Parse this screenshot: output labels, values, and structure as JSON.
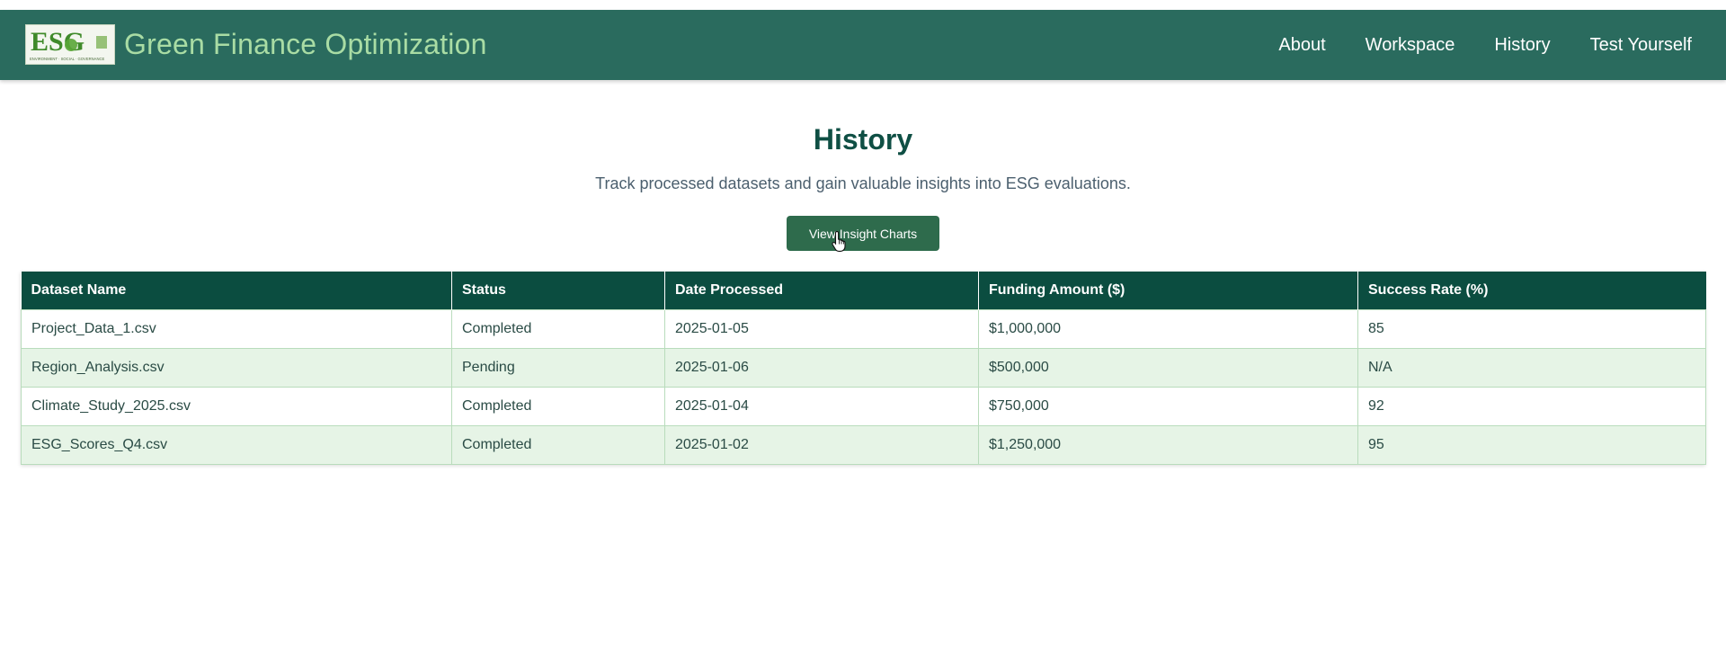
{
  "header": {
    "logo_text": "ESG",
    "logo_subtext": "ENVIRONMENT · SOCIAL · GOVERNANCE",
    "title": "Green Finance Optimization",
    "nav": [
      {
        "label": "About"
      },
      {
        "label": "Workspace"
      },
      {
        "label": "History"
      },
      {
        "label": "Test Yourself"
      }
    ]
  },
  "main": {
    "title": "History",
    "subtitle": "Track processed datasets and gain valuable insights into ESG evaluations.",
    "button_label": "View Insight Charts"
  },
  "table": {
    "columns": [
      "Dataset Name",
      "Status",
      "Date Processed",
      "Funding Amount ($)",
      "Success Rate (%)"
    ],
    "rows": [
      [
        "Project_Data_1.csv",
        "Completed",
        "2025-01-05",
        "$1,000,000",
        "85"
      ],
      [
        "Region_Analysis.csv",
        "Pending",
        "2025-01-06",
        "$500,000",
        "N/A"
      ],
      [
        "Climate_Study_2025.csv",
        "Completed",
        "2025-01-04",
        "$750,000",
        "92"
      ],
      [
        "ESG_Scores_Q4.csv",
        "Completed",
        "2025-01-02",
        "$1,250,000",
        "95"
      ]
    ]
  },
  "colors": {
    "navbar": "#2a6b5e",
    "brand_title": "#a9dca4",
    "heading": "#0f4f44",
    "table_header": "#0b4d40",
    "row_alt": "#e6f4e6",
    "button": "#2e6b4c"
  },
  "icons": {
    "cursor": "hand-pointer-icon"
  }
}
